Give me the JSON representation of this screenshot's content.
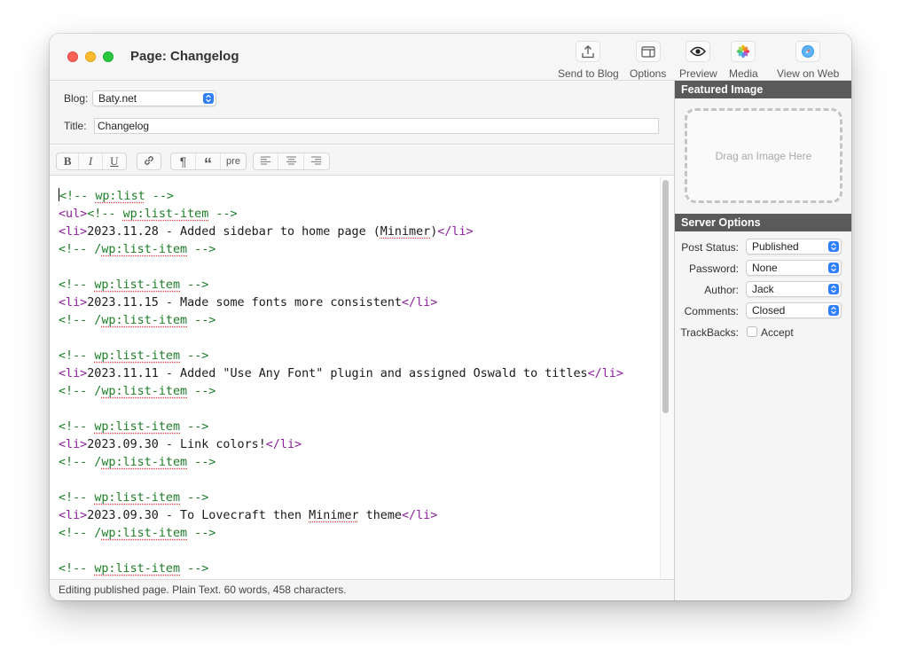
{
  "window": {
    "title": "Page: Changelog"
  },
  "toolbar": [
    {
      "label": "Send to Blog",
      "icon": "upload-icon"
    },
    {
      "label": "Options",
      "icon": "window-icon"
    },
    {
      "label": "Preview",
      "icon": "eye-icon"
    },
    {
      "label": "Media",
      "icon": "photos-icon"
    },
    {
      "label": "View on Web",
      "icon": "compass-icon"
    }
  ],
  "meta": {
    "blog_label": "Blog:",
    "blog_value": "Baty.net",
    "title_label": "Title:",
    "title_value": "Changelog"
  },
  "format": {
    "bold": "B",
    "italic": "I",
    "underline": "U",
    "link": "link-icon",
    "paragraph": "¶",
    "quote": "“",
    "pre": "pre",
    "align_left": "align-left-icon",
    "align_center": "align-center-icon",
    "align_right": "align-right-icon"
  },
  "editor": {
    "lines": [
      {
        "parts": [
          [
            "c",
            "<!-- "
          ],
          [
            "c sq",
            "wp:list"
          ],
          [
            "c",
            " -->"
          ]
        ]
      },
      {
        "parts": [
          [
            "t",
            "<ul>"
          ],
          [
            "c",
            "<!-- "
          ],
          [
            "c sq",
            "wp:list-item"
          ],
          [
            "c",
            " -->"
          ]
        ]
      },
      {
        "parts": [
          [
            "t",
            "<li>"
          ],
          [
            "x",
            "2023.11.28 - Added sidebar to home page ("
          ],
          [
            "x sq",
            "Minimer"
          ],
          [
            "x",
            ")"
          ],
          [
            "t",
            "</li>"
          ]
        ]
      },
      {
        "parts": [
          [
            "c",
            "<!-- /"
          ],
          [
            "c sq",
            "wp:list-item"
          ],
          [
            "c",
            " -->"
          ]
        ]
      },
      {
        "parts": []
      },
      {
        "parts": [
          [
            "c",
            "<!-- "
          ],
          [
            "c sq",
            "wp:list-item"
          ],
          [
            "c",
            " -->"
          ]
        ]
      },
      {
        "parts": [
          [
            "t",
            "<li>"
          ],
          [
            "x",
            "2023.11.15 - Made some fonts more consistent"
          ],
          [
            "t",
            "</li>"
          ]
        ]
      },
      {
        "parts": [
          [
            "c",
            "<!-- /"
          ],
          [
            "c sq",
            "wp:list-item"
          ],
          [
            "c",
            " -->"
          ]
        ]
      },
      {
        "parts": []
      },
      {
        "parts": [
          [
            "c",
            "<!-- "
          ],
          [
            "c sq",
            "wp:list-item"
          ],
          [
            "c",
            " -->"
          ]
        ]
      },
      {
        "parts": [
          [
            "t",
            "<li>"
          ],
          [
            "x",
            "2023.11.11 - Added \"Use Any Font\" plugin and assigned Oswald to titles"
          ],
          [
            "t",
            "</li>"
          ]
        ]
      },
      {
        "parts": [
          [
            "c",
            "<!-- /"
          ],
          [
            "c sq",
            "wp:list-item"
          ],
          [
            "c",
            " -->"
          ]
        ]
      },
      {
        "parts": []
      },
      {
        "parts": [
          [
            "c",
            "<!-- "
          ],
          [
            "c sq",
            "wp:list-item"
          ],
          [
            "c",
            " -->"
          ]
        ]
      },
      {
        "parts": [
          [
            "t",
            "<li>"
          ],
          [
            "x",
            "2023.09.30 - Link colors!"
          ],
          [
            "t",
            "</li>"
          ]
        ]
      },
      {
        "parts": [
          [
            "c",
            "<!-- /"
          ],
          [
            "c sq",
            "wp:list-item"
          ],
          [
            "c",
            " -->"
          ]
        ]
      },
      {
        "parts": []
      },
      {
        "parts": [
          [
            "c",
            "<!-- "
          ],
          [
            "c sq",
            "wp:list-item"
          ],
          [
            "c",
            " -->"
          ]
        ]
      },
      {
        "parts": [
          [
            "t",
            "<li>"
          ],
          [
            "x",
            "2023.09.30 - To Lovecraft then "
          ],
          [
            "x sq",
            "Minimer"
          ],
          [
            "x",
            " theme"
          ],
          [
            "t",
            "</li>"
          ]
        ]
      },
      {
        "parts": [
          [
            "c",
            "<!-- /"
          ],
          [
            "c sq",
            "wp:list-item"
          ],
          [
            "c",
            " -->"
          ]
        ]
      },
      {
        "parts": []
      },
      {
        "parts": [
          [
            "c",
            "<!-- "
          ],
          [
            "c sq",
            "wp:list-item"
          ],
          [
            "c",
            " -->"
          ]
        ]
      }
    ]
  },
  "status": "Editing published page. Plain Text. 60 words, 458 characters.",
  "sidebar": {
    "featured_header": "Featured Image",
    "drop_text": "Drag an Image Here",
    "server_header": "Server Options",
    "options": [
      {
        "label": "Post Status:",
        "value": "Published"
      },
      {
        "label": "Password:",
        "value": "None"
      },
      {
        "label": "Author:",
        "value": "Jack"
      },
      {
        "label": "Comments:",
        "value": "Closed"
      }
    ],
    "trackbacks_label": "TrackBacks:",
    "trackbacks_value": "Accept"
  }
}
